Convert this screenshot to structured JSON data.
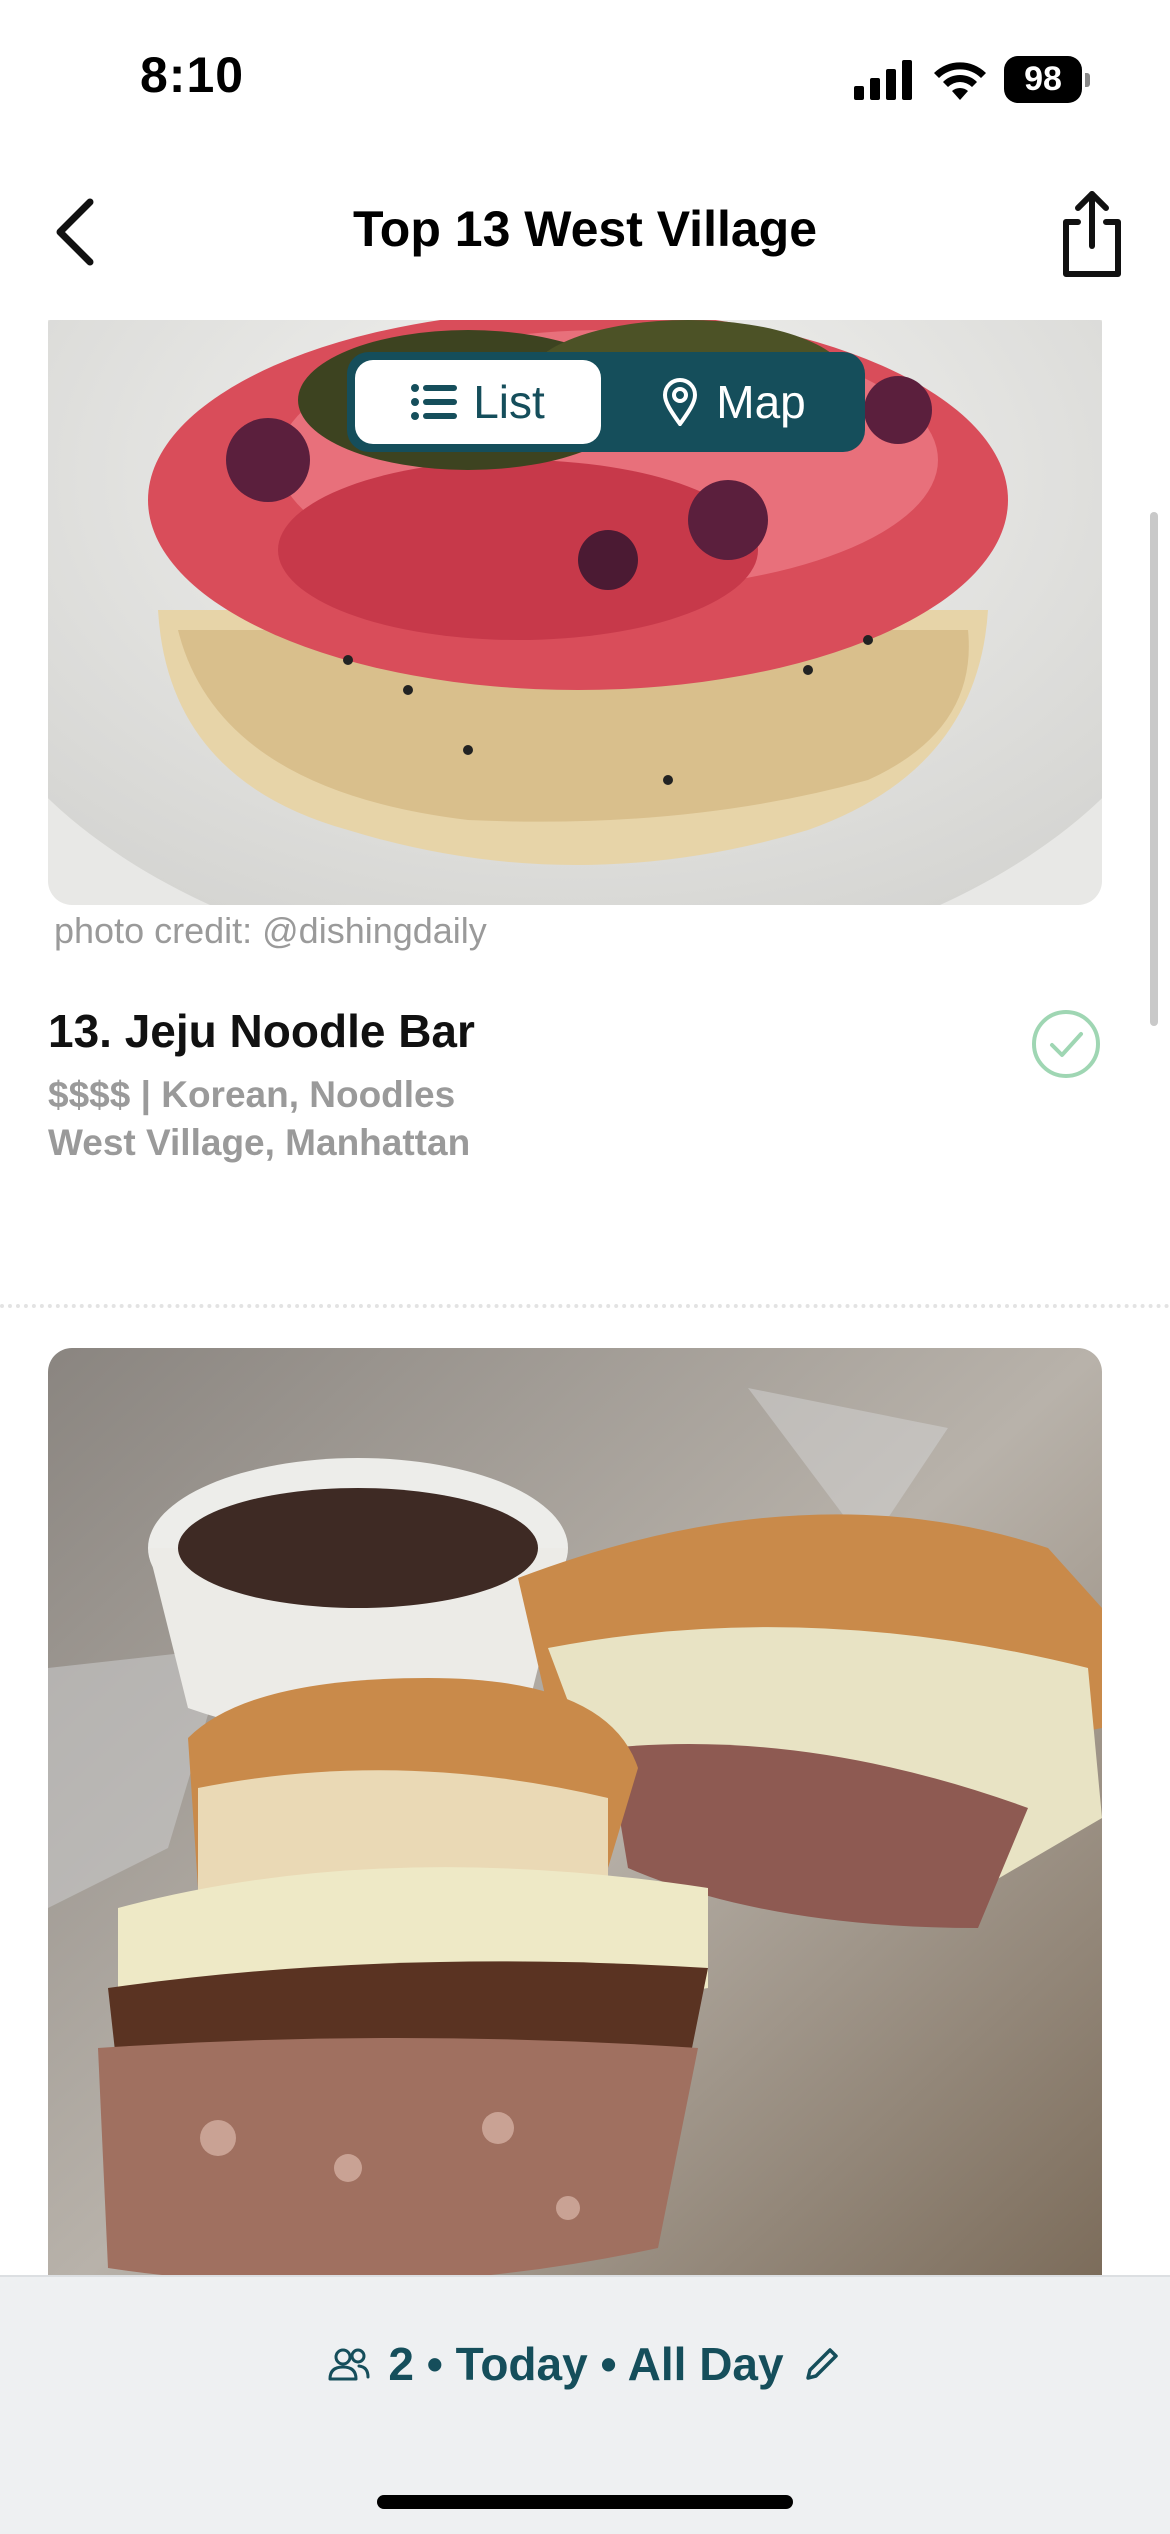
{
  "status_bar": {
    "time": "8:10",
    "battery": "98"
  },
  "nav": {
    "title": "Top 13 West Village"
  },
  "view_toggle": {
    "list_label": "List",
    "map_label": "Map",
    "active": "List"
  },
  "restaurant": {
    "photo_credit": "photo credit: @dishingdaily",
    "name": "13. Jeju Noodle Bar",
    "meta": "$$$$ | Korean, Noodles",
    "location": "West Village, Manhattan",
    "visited": true
  },
  "reservation": {
    "text": "2 • Today • All Day"
  },
  "colors": {
    "accent": "#154e5b",
    "muted_text": "#9a9a9a",
    "check": "#9fd6b3",
    "bottom_bar": "#eef0f2"
  },
  "icons": [
    "back-icon",
    "share-icon",
    "list-icon",
    "map-pin-icon",
    "check-circle-icon",
    "people-icon",
    "pencil-icon",
    "cellular-icon",
    "wifi-icon"
  ]
}
